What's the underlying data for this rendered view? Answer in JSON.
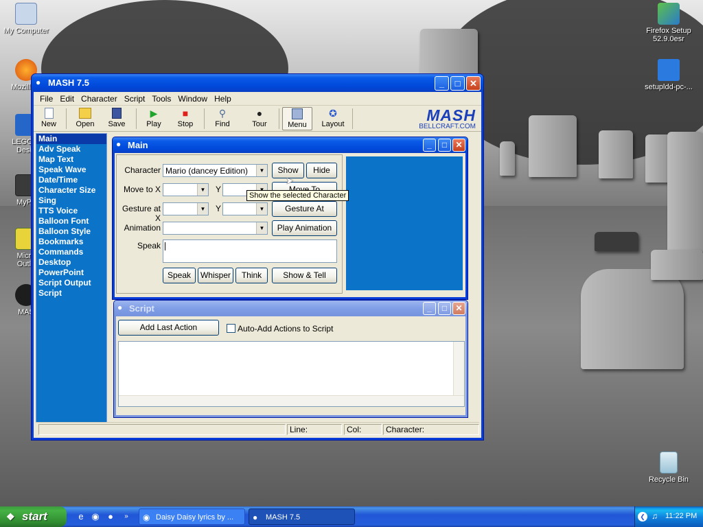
{
  "desktop": {
    "icons_left": [
      {
        "label": "My Computer"
      },
      {
        "label": "Mozilla F"
      },
      {
        "label": "LEGO D"
      },
      {
        "label": "Desig"
      },
      {
        "label": "MyPa"
      },
      {
        "label": "Micro"
      },
      {
        "label": "Outlo"
      },
      {
        "label": "MAS"
      }
    ],
    "icons_right": [
      {
        "label_line1": "Firefox Setup",
        "label_line2": "52.9.0esr"
      },
      {
        "label_line1": "setupldd-pc-...",
        "label_line2": ""
      },
      {
        "label_line1": "Recycle Bin",
        "label_line2": ""
      }
    ]
  },
  "window": {
    "title": "MASH 7.5",
    "menu": [
      "File",
      "Edit",
      "Character",
      "Script",
      "Tools",
      "Window",
      "Help"
    ],
    "toolbar": {
      "new": "New",
      "open": "Open",
      "save": "Save",
      "play": "Play",
      "stop": "Stop",
      "find": "Find",
      "tour": "Tour",
      "menu": "Menu",
      "layout": "Layout"
    },
    "logo": {
      "brand": "MASH",
      "site": "BELLCRAFT.COM"
    },
    "sidebar": [
      "Main",
      "Adv Speak",
      "Map Text",
      "Speak Wave",
      "Date/Time",
      "Character Size",
      "Sing",
      "TTS Voice",
      "Balloon Font",
      "Balloon Style",
      "Bookmarks",
      "Commands",
      "Desktop",
      "PowerPoint",
      "Script Output",
      "Script"
    ],
    "status": {
      "line": "Line:",
      "col": "Col:",
      "character": "Character:"
    }
  },
  "main_panel": {
    "title": "Main",
    "character_label": "Character",
    "character_value": "Mario (dancey Edition)",
    "moveto_label": "Move to X",
    "gestureat_label": "Gesture at X",
    "y_label": "Y",
    "animation_label": "Animation",
    "speak_label": "Speak",
    "buttons": {
      "show": "Show",
      "hide": "Hide",
      "move_to": "Move To",
      "gesture_at": "Gesture At",
      "play_animation": "Play Animation",
      "speak": "Speak",
      "whisper": "Whisper",
      "think": "Think",
      "show_tell": "Show & Tell"
    },
    "tooltip": "Show the selected Character"
  },
  "script_panel": {
    "title": "Script",
    "add_last_action": "Add Last Action",
    "auto_add": "Auto-Add Actions to Script"
  },
  "taskbar": {
    "start": "start",
    "tasks": [
      {
        "label": "Daisy Daisy lyrics by ..."
      },
      {
        "label": "MASH 7.5"
      }
    ],
    "clock": "11:22 PM"
  }
}
